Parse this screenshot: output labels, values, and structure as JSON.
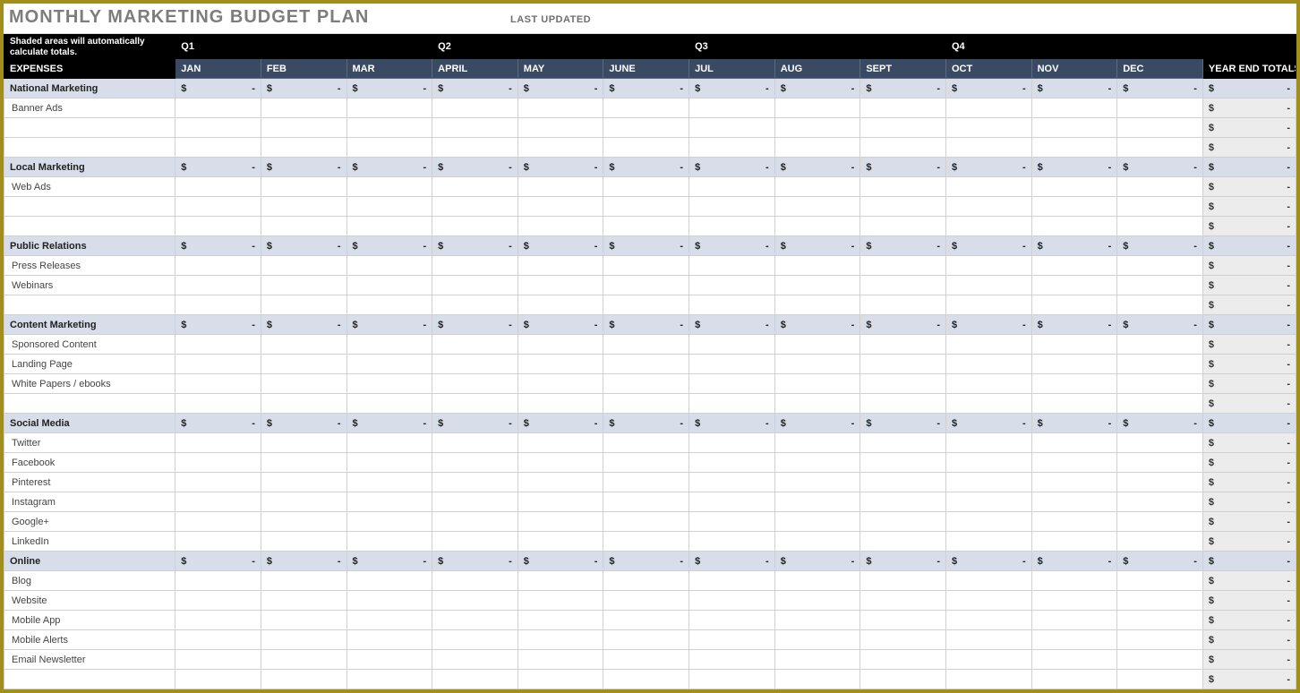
{
  "title": "MONTHLY MARKETING BUDGET PLAN",
  "last_updated_label": "LAST UPDATED",
  "header_note": "Shaded areas will automatically calculate totals.",
  "expenses_label": "EXPENSES",
  "year_end_label": "YEAR END TOTALS",
  "quarters": [
    "Q1",
    "Q2",
    "Q3",
    "Q4"
  ],
  "months": [
    "JAN",
    "FEB",
    "MAR",
    "APRIL",
    "MAY",
    "JUNE",
    "JUL",
    "AUG",
    "SEPT",
    "OCT",
    "NOV",
    "DEC"
  ],
  "currency": "$",
  "dash": "-",
  "sections": [
    {
      "name": "National Marketing",
      "items": [
        "Banner Ads",
        "",
        ""
      ]
    },
    {
      "name": "Local Marketing",
      "items": [
        "Web Ads",
        "",
        ""
      ]
    },
    {
      "name": "Public Relations",
      "items": [
        "Press Releases",
        "Webinars",
        ""
      ]
    },
    {
      "name": "Content Marketing",
      "items": [
        "Sponsored Content",
        "Landing Page",
        "White Papers / ebooks",
        ""
      ]
    },
    {
      "name": "Social Media",
      "items": [
        "Twitter",
        "Facebook",
        "Pinterest",
        "Instagram",
        "Google+",
        "LinkedIn"
      ]
    },
    {
      "name": "Online",
      "items": [
        "Blog",
        "Website",
        "Mobile App",
        "Mobile Alerts",
        "Email Newsletter",
        ""
      ]
    }
  ]
}
